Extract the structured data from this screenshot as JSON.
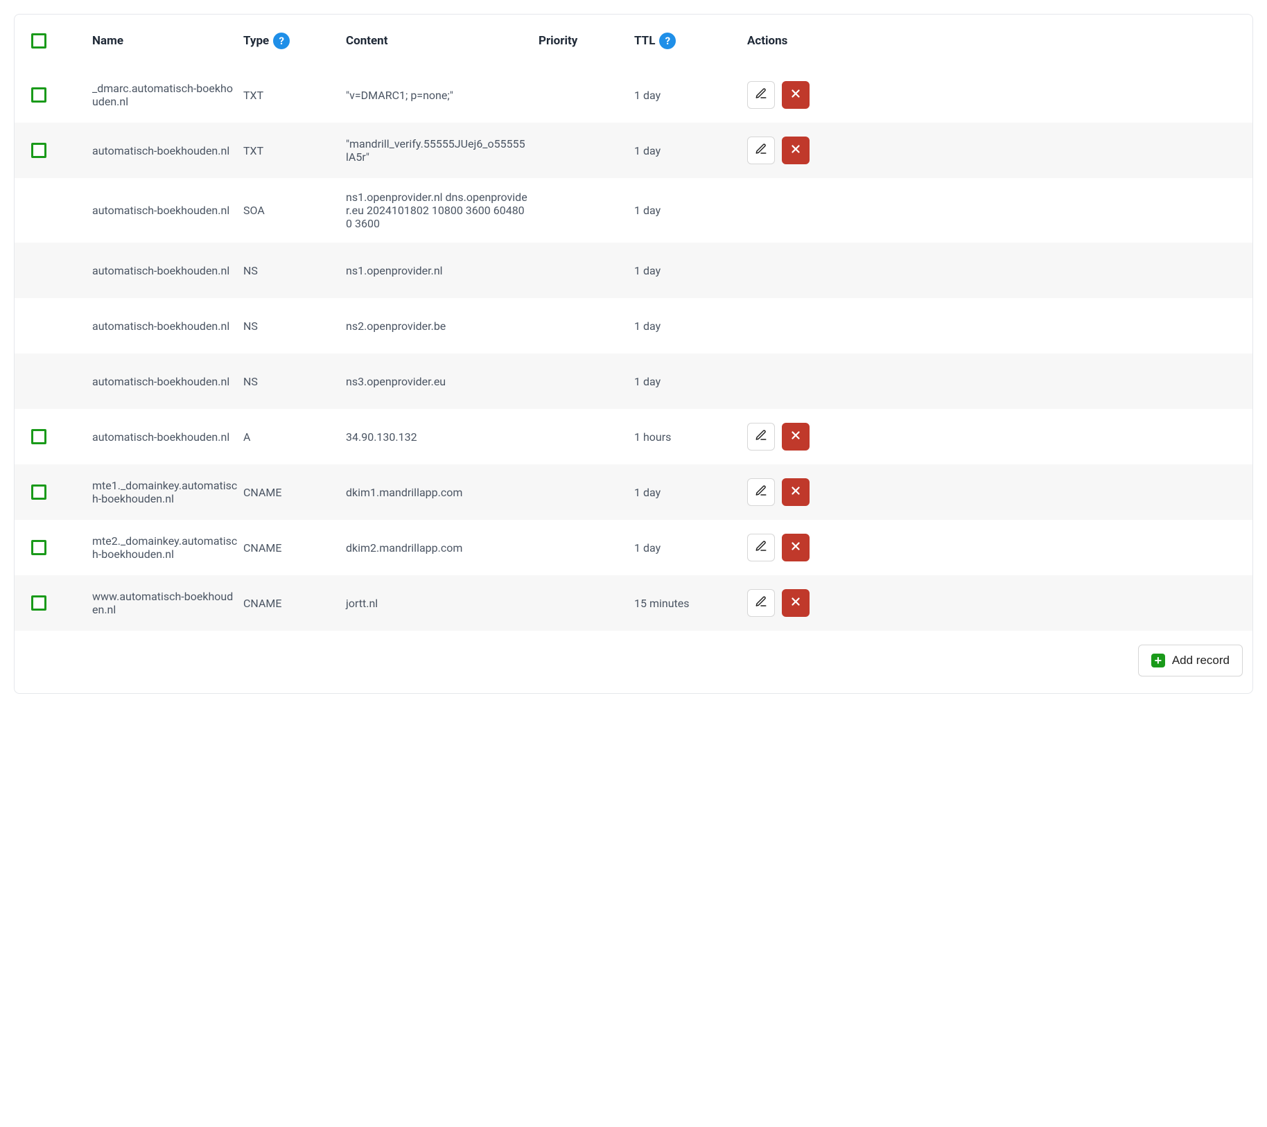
{
  "table": {
    "headers": {
      "name": "Name",
      "type": "Type",
      "content": "Content",
      "priority": "Priority",
      "ttl": "TTL",
      "actions": "Actions"
    },
    "rows": [
      {
        "selectable": true,
        "name": "_dmarc.automatisch-boekhouden.nl",
        "type": "TXT",
        "content": "\"v=DMARC1; p=none;\"",
        "priority": "",
        "ttl": "1 day",
        "editable": true
      },
      {
        "selectable": true,
        "name": "automatisch-boekhouden.nl",
        "type": "TXT",
        "content": "\"mandrill_verify.55555JUej6_o55555lA5r\"",
        "priority": "",
        "ttl": "1 day",
        "editable": true
      },
      {
        "selectable": false,
        "name": "automatisch-boekhouden.nl",
        "type": "SOA",
        "content": "ns1.openprovider.nl dns.openprovider.eu 2024101802 10800 3600 604800 3600",
        "priority": "",
        "ttl": "1 day",
        "editable": false
      },
      {
        "selectable": false,
        "name": "automatisch-boekhouden.nl",
        "type": "NS",
        "content": "ns1.openprovider.nl",
        "priority": "",
        "ttl": "1 day",
        "editable": false
      },
      {
        "selectable": false,
        "name": "automatisch-boekhouden.nl",
        "type": "NS",
        "content": "ns2.openprovider.be",
        "priority": "",
        "ttl": "1 day",
        "editable": false
      },
      {
        "selectable": false,
        "name": "automatisch-boekhouden.nl",
        "type": "NS",
        "content": "ns3.openprovider.eu",
        "priority": "",
        "ttl": "1 day",
        "editable": false
      },
      {
        "selectable": true,
        "name": "automatisch-boekhouden.nl",
        "type": "A",
        "content": "34.90.130.132",
        "priority": "",
        "ttl": "1 hours",
        "editable": true
      },
      {
        "selectable": true,
        "name": "mte1._domainkey.automatisch-boekhouden.nl",
        "type": "CNAME",
        "content": "dkim1.mandrillapp.com",
        "priority": "",
        "ttl": "1 day",
        "editable": true
      },
      {
        "selectable": true,
        "name": "mte2._domainkey.automatisch-boekhouden.nl",
        "type": "CNAME",
        "content": "dkim2.mandrillapp.com",
        "priority": "",
        "ttl": "1 day",
        "editable": true
      },
      {
        "selectable": true,
        "name": "www.automatisch-boekhouden.nl",
        "type": "CNAME",
        "content": "jortt.nl",
        "priority": "",
        "ttl": "15 minutes",
        "editable": true
      }
    ]
  },
  "footer": {
    "add_record_label": "Add record"
  },
  "icons": {
    "help_glyph": "?",
    "plus_glyph": "+"
  }
}
